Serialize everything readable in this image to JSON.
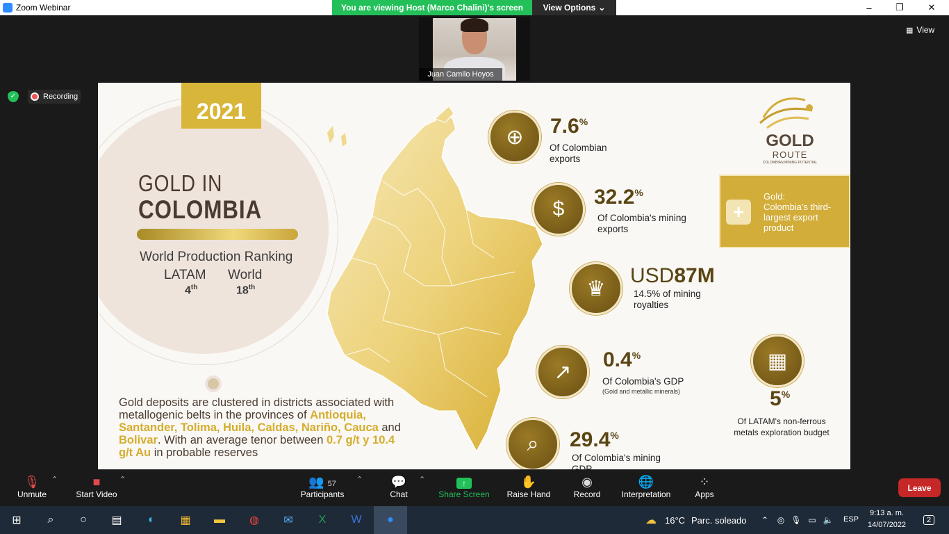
{
  "window": {
    "app_title": "Zoom Webinar",
    "banner": "You are viewing Host (Marco Chalini)'s screen",
    "view_options": "View Options",
    "minimize": "–",
    "maximize": "❐",
    "close": "✕",
    "view_label": "View"
  },
  "video": {
    "participant_name": "Juan Camilo Hoyos"
  },
  "status": {
    "recording_label": "Recording"
  },
  "slide": {
    "year": "2021",
    "heading_line1": "GOLD IN",
    "heading_line2": "COLOMBIA",
    "ranking_title": "World Production Ranking",
    "latam_label": "LATAM",
    "world_label": "World",
    "latam_rank": "4",
    "latam_rank_suffix": "th",
    "world_rank": "18",
    "world_rank_suffix": "th",
    "body_text_1": "Gold deposits are clustered in districts associated with metallogenic belts in the provinces of ",
    "body_highlight_1": "Antioquia, Santander, Tolima, Huila, Caldas, Nariño, Cauca",
    "body_text_2": " and ",
    "body_highlight_2": "Bolivar",
    "body_text_3": ". With an average tenor between ",
    "body_highlight_3": "0.7 g/t y 10.4 g/t Au",
    "body_text_4": " in probable reserves",
    "stats": [
      {
        "value": "7.6",
        "suffix": "%",
        "desc": "Of Colombian exports",
        "icon": "globe-trade-icon"
      },
      {
        "value": "32.2",
        "suffix": "%",
        "desc": "Of Colombia's mining exports",
        "icon": "coin-cycle-icon"
      },
      {
        "value_prefix": "USD",
        "value": "87M",
        "desc": "14.5% of mining royalties",
        "icon": "money-crown-icon"
      },
      {
        "value": "0.4",
        "suffix": "%",
        "desc": "Of Colombia's GDP",
        "fine": "(Gold and metallic minerals)",
        "icon": "growth-chart-icon"
      },
      {
        "value": "29.4",
        "suffix": "%",
        "desc": "Of Colombia's mining GDP",
        "icon": "report-search-icon"
      },
      {
        "value": "5",
        "suffix": "%",
        "desc": "Of LATAM's non-ferrous metals exploration budget",
        "icon": "calculator-doc-icon"
      }
    ],
    "logo": {
      "line1": "GOLD",
      "line2": "ROUTE",
      "line3": "COLOMBIAN MINING POTENTIAL"
    },
    "callout": {
      "title": "Gold:",
      "text": "Colombia's third-largest export product"
    }
  },
  "toolbar": {
    "unmute": "Unmute",
    "start_video": "Start Video",
    "participants": "Participants",
    "participants_count": "57",
    "chat": "Chat",
    "share_screen": "Share Screen",
    "raise_hand": "Raise Hand",
    "record": "Record",
    "interpretation": "Interpretation",
    "apps": "Apps",
    "leave": "Leave"
  },
  "taskbar": {
    "weather_temp": "16°C",
    "weather_desc": "Parc. soleado",
    "language": "ESP",
    "time": "9:13 a. m.",
    "date": "14/07/2022",
    "notifications": "2"
  }
}
